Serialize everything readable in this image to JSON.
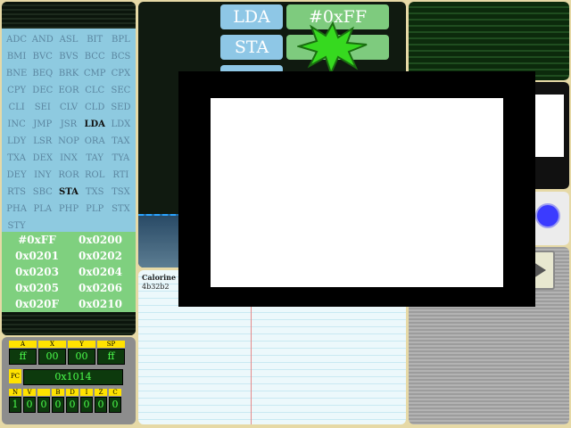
{
  "opcodes": [
    "ADC",
    "AND",
    "ASL",
    "BIT",
    "BPL",
    "BMI",
    "BVC",
    "BVS",
    "BCC",
    "BCS",
    "BNE",
    "BEQ",
    "BRK",
    "CMP",
    "CPX",
    "CPY",
    "DEC",
    "EOR",
    "CLC",
    "SEC",
    "CLI",
    "SEI",
    "CLV",
    "CLD",
    "SED",
    "INC",
    "JMP",
    "JSR",
    "LDA",
    "LDX",
    "LDY",
    "LSR",
    "NOP",
    "ORA",
    "TAX",
    "TXA",
    "DEX",
    "INX",
    "TAY",
    "TYA",
    "DEY",
    "INY",
    "ROR",
    "ROL",
    "RTI",
    "RTS",
    "SBC",
    "STA",
    "TXS",
    "TSX",
    "PHA",
    "PLA",
    "PHP",
    "PLP",
    "STX",
    "STY"
  ],
  "highlighted_opcodes": [
    "LDA",
    "STA"
  ],
  "memory": [
    "#0xFF",
    "0x0200",
    "0x0201",
    "0x0202",
    "0x0203",
    "0x0204",
    "0x0205",
    "0x0206",
    "0x020F",
    "0x0210"
  ],
  "registers": {
    "labels": [
      "A",
      "X",
      "Y",
      "SP"
    ],
    "values": [
      "ff",
      "00",
      "00",
      "ff"
    ],
    "pc_label": "PC",
    "pc_value": "0x1014",
    "flag_labels": [
      "N",
      "V",
      "",
      "B",
      "D",
      "I",
      "Z",
      "C"
    ],
    "flag_values": [
      "1",
      "0",
      "0",
      "0",
      "0",
      "0",
      "0",
      "0"
    ]
  },
  "tiles": {
    "row1_op": "LDA",
    "row1_arg": "#0xFF",
    "row2_op": "STA",
    "row2_arg": "",
    "row3_op": ""
  },
  "notes": {
    "title": "Calorine",
    "line": "4b32b2"
  },
  "colors": {
    "opcode_bg": "#8ecae0",
    "memory_bg": "#7fd07f",
    "burst": "#36d91f",
    "accent_blue": "#3b3bff"
  }
}
